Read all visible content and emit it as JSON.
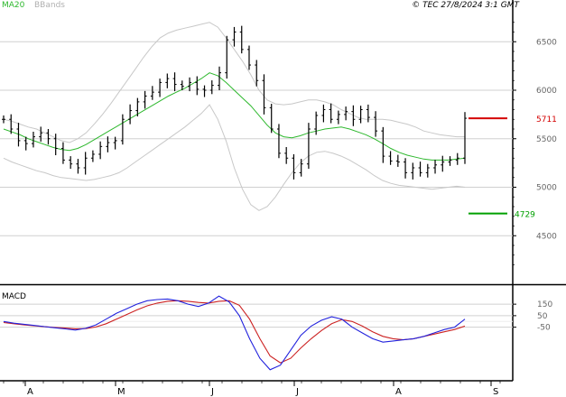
{
  "header": {
    "ma_label": "MA20",
    "bb_label": "BBands",
    "timestamp": "© TEC 27/8/2024 3:1 GMT"
  },
  "colors": {
    "ma": "#2db82d",
    "bbands": "#c8c8c8",
    "price": "#000000",
    "resistance": "#d40000",
    "support": "#00a000",
    "macd_line": "#2222dd",
    "signal_line": "#cc2222",
    "grid": "#d0d0d0"
  },
  "chart_data": {
    "type": "ohlc",
    "x_axis": {
      "months": [
        "A",
        "M",
        "J",
        "J",
        "A",
        "S"
      ]
    },
    "price_panel": {
      "y_ticks": [
        4500,
        5000,
        5500,
        6000,
        6500
      ],
      "y_tick_labels": [
        "4500",
        "5000",
        "5500",
        "6000",
        "6500"
      ],
      "resistance": {
        "value": 5711,
        "label": "5711"
      },
      "support": {
        "value": 4729,
        "label": "4729"
      },
      "closes": [
        5700,
        5600,
        5480,
        5450,
        5520,
        5560,
        5500,
        5400,
        5280,
        5240,
        5200,
        5300,
        5340,
        5420,
        5460,
        5480,
        5700,
        5790,
        5880,
        5940,
        5980,
        6080,
        6120,
        6060,
        6040,
        6080,
        6010,
        6000,
        6050,
        6180,
        6520,
        6600,
        6420,
        6260,
        6100,
        5820,
        5600,
        5350,
        5300,
        5150,
        5240,
        5600,
        5740,
        5800,
        5700,
        5750,
        5780,
        5700,
        5800,
        5720,
        5580,
        5320,
        5270,
        5260,
        5150,
        5200,
        5150,
        5200,
        5230,
        5260,
        5280,
        5300,
        5711
      ],
      "ma20": [
        5600,
        5570,
        5540,
        5500,
        5470,
        5440,
        5410,
        5390,
        5380,
        5400,
        5440,
        5490,
        5540,
        5590,
        5640,
        5690,
        5740,
        5790,
        5840,
        5890,
        5940,
        5980,
        6020,
        6070,
        6120,
        6180,
        6150,
        6080,
        6000,
        5920,
        5840,
        5740,
        5640,
        5560,
        5520,
        5510,
        5530,
        5560,
        5580,
        5600,
        5610,
        5620,
        5600,
        5570,
        5540,
        5500,
        5450,
        5400,
        5360,
        5330,
        5310,
        5290,
        5280,
        5280,
        5280,
        5290,
        5300
      ],
      "bb_upper": [
        5700,
        5680,
        5650,
        5620,
        5600,
        5560,
        5520,
        5480,
        5460,
        5500,
        5560,
        5650,
        5750,
        5860,
        5980,
        6100,
        6220,
        6340,
        6450,
        6540,
        6590,
        6620,
        6640,
        6660,
        6680,
        6700,
        6650,
        6540,
        6420,
        6300,
        6160,
        6000,
        5900,
        5860,
        5850,
        5860,
        5880,
        5900,
        5900,
        5880,
        5850,
        5800,
        5760,
        5720,
        5700,
        5700,
        5700,
        5690,
        5670,
        5650,
        5620,
        5580,
        5560,
        5540,
        5530,
        5520,
        5520
      ],
      "bb_lower": [
        5300,
        5260,
        5230,
        5200,
        5170,
        5150,
        5120,
        5100,
        5090,
        5080,
        5070,
        5080,
        5100,
        5120,
        5150,
        5200,
        5260,
        5320,
        5380,
        5440,
        5500,
        5560,
        5620,
        5690,
        5760,
        5850,
        5700,
        5480,
        5200,
        4980,
        4820,
        4760,
        4800,
        4900,
        5030,
        5150,
        5250,
        5320,
        5360,
        5370,
        5350,
        5320,
        5280,
        5230,
        5180,
        5120,
        5070,
        5040,
        5020,
        5010,
        5000,
        4990,
        4980,
        4990,
        5000,
        5010,
        5000
      ]
    },
    "macd_panel": {
      "title": "MACD",
      "y_ticks": [
        150,
        50,
        -50
      ],
      "y_tick_labels": [
        "150",
        "50",
        "-50"
      ],
      "macd": [
        0,
        -15,
        -25,
        -35,
        -45,
        -55,
        -65,
        -75,
        -60,
        -30,
        20,
        70,
        110,
        150,
        180,
        190,
        195,
        180,
        150,
        130,
        160,
        220,
        170,
        50,
        -150,
        -320,
        -420,
        -380,
        -250,
        -120,
        -40,
        10,
        40,
        20,
        -50,
        -100,
        -150,
        -180,
        -170,
        -160,
        -150,
        -130,
        -100,
        -70,
        -50,
        20
      ],
      "signal": [
        -10,
        -20,
        -30,
        -38,
        -46,
        -52,
        -58,
        -64,
        -62,
        -48,
        -20,
        20,
        60,
        100,
        135,
        160,
        175,
        180,
        175,
        165,
        160,
        175,
        180,
        140,
        20,
        -150,
        -300,
        -360,
        -320,
        -230,
        -150,
        -80,
        -20,
        15,
        0,
        -40,
        -90,
        -130,
        -150,
        -160,
        -150,
        -130,
        -110,
        -90,
        -70,
        -40
      ]
    }
  }
}
